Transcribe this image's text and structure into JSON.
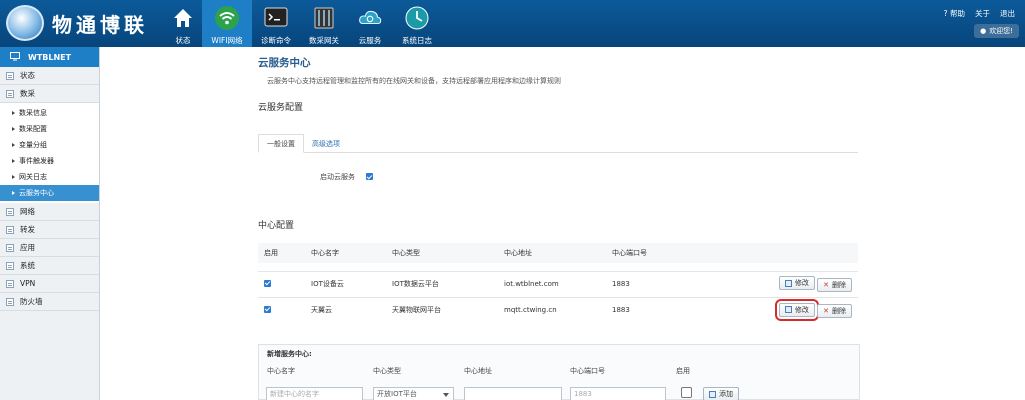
{
  "header": {
    "logo_text": "物通博联",
    "nav": [
      {
        "label": "状态",
        "icon": "home-icon"
      },
      {
        "label": "WIFI网络",
        "icon": "wifi-icon",
        "active": true
      },
      {
        "label": "诊断命令",
        "icon": "terminal-icon"
      },
      {
        "label": "数采网关",
        "icon": "gateway-icon"
      },
      {
        "label": "云服务",
        "icon": "cloud-icon"
      },
      {
        "label": "系统日志",
        "icon": "log-icon"
      }
    ],
    "help": "帮助",
    "about": "关于",
    "logout": "退出",
    "welcome": "欢迎您!"
  },
  "sidebar": {
    "title": "WTBLNET",
    "sections_top": [
      "状态",
      "数采"
    ],
    "sub_items": [
      {
        "label": "数采信息"
      },
      {
        "label": "数采配置"
      },
      {
        "label": "变量分组"
      },
      {
        "label": "事件触发器"
      },
      {
        "label": "网关日志"
      },
      {
        "label": "云服务中心",
        "active": true
      }
    ],
    "sections_bottom": [
      "网络",
      "转发",
      "应用",
      "系统",
      "VPN",
      "防火墙"
    ]
  },
  "main": {
    "title": "云服务中心",
    "description": "云服务中心支持远程管理和监控所有的在线网关和设备，支持远程部署应用程序和边缘计算规则",
    "config_heading": "云服务配置",
    "tabs": [
      {
        "label": "一般设置",
        "active": true
      },
      {
        "label": "高级选项"
      }
    ],
    "enable_label": "启动云服务",
    "enable_checked": true,
    "center_heading": "中心配置",
    "table": {
      "headers": [
        "启用",
        "中心名字",
        "中心类型",
        "中心地址",
        "中心端口号"
      ],
      "rows": [
        {
          "enabled": true,
          "name": "IOT设备云",
          "type": "IOT数据云平台",
          "address": "iot.wtblnet.com",
          "port": "1883"
        },
        {
          "enabled": true,
          "name": "天翼云",
          "type": "天翼物联网平台",
          "address": "mqtt.ctwing.cn",
          "port": "1883"
        }
      ],
      "edit_label": "修改",
      "delete_label": "删除"
    },
    "new_service": {
      "title": "新增服务中心:",
      "headers": [
        "中心名字",
        "中心类型",
        "中心地址",
        "中心端口号",
        "启用"
      ],
      "name_placeholder": "新建中心的名字",
      "type_value": "开放IOT平台",
      "port_placeholder": "1883",
      "add_label": "添加"
    }
  }
}
